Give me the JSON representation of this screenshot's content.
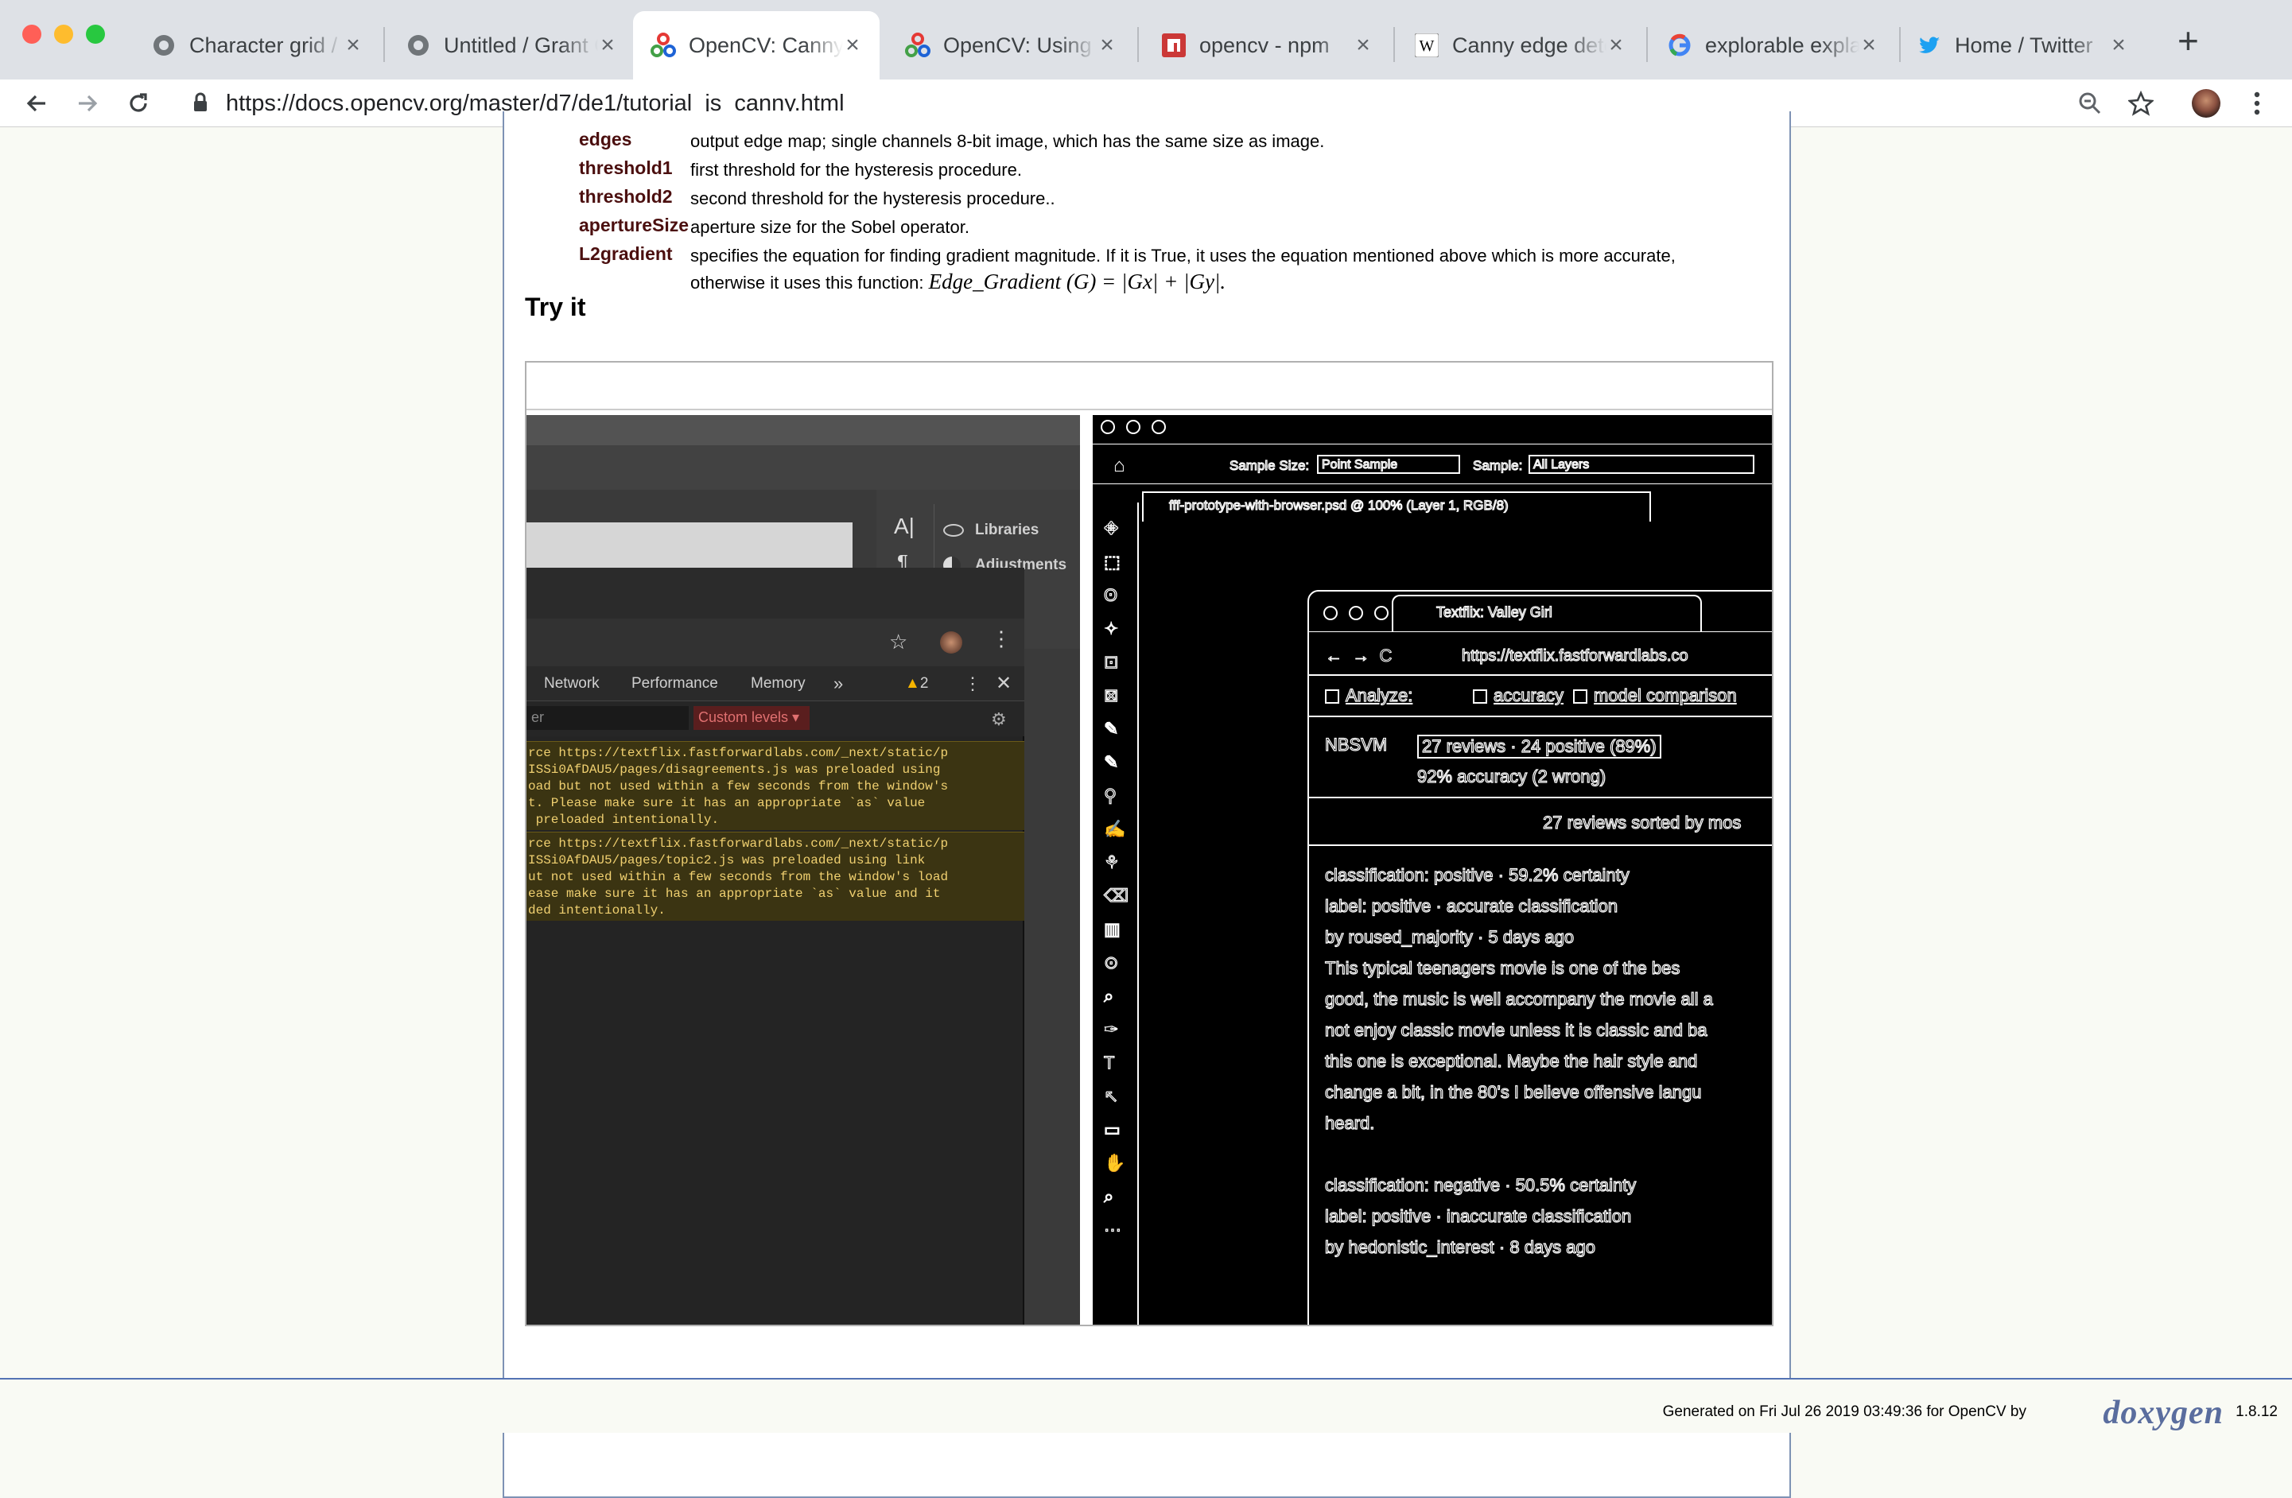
{
  "window": {
    "traffic_colors": [
      "#ff5f57",
      "#febc2e",
      "#28c840"
    ]
  },
  "tabs": [
    {
      "title": "Character grid / G",
      "icon": "observable-icon"
    },
    {
      "title": "Untitled / Grant G",
      "icon": "observable-icon"
    },
    {
      "title": "OpenCV: Canny E",
      "icon": "opencv-icon",
      "active": true
    },
    {
      "title": "OpenCV: Using O",
      "icon": "opencv-icon"
    },
    {
      "title": "opencv - npm",
      "icon": "npm-icon"
    },
    {
      "title": "Canny edge dete",
      "icon": "wikipedia-icon"
    },
    {
      "title": "explorable expla",
      "icon": "google-icon"
    },
    {
      "title": "Home / Twitter",
      "icon": "twitter-icon"
    }
  ],
  "toolbar": {
    "url": "https://docs.opencv.org/master/d7/de1/tutorial_js_canny.html"
  },
  "params": [
    {
      "name": "edges",
      "desc": "output edge map; single channels 8-bit image, which has the same size as image."
    },
    {
      "name": "threshold1",
      "desc": "first threshold for the hysteresis procedure."
    },
    {
      "name": "threshold2",
      "desc": "second threshold for the hysteresis procedure.."
    },
    {
      "name": "apertureSize",
      "desc": "aperture size for the Sobel operator."
    },
    {
      "name": "L2gradient",
      "desc": "specifies the equation for finding gradient magnitude. If it is True, it uses the equation mentioned above which is more accurate,",
      "desc2": "otherwise it uses this function:",
      "math": "Edge_Gradient (G) = |Gx| + |Gy|."
    }
  ],
  "section_title": "Try it",
  "left_image": {
    "panel_items": [
      "Libraries",
      "Adjustments"
    ],
    "devtools_tabs": [
      "Network",
      "Performance",
      "Memory",
      "»"
    ],
    "warning_count": "2",
    "filter_placeholder": "er",
    "levels_label": "Custom levels ▾",
    "console_1": "rce https://textflix.fastforwardlabs.com/_next/static/p\nISSi0AfDAU5/pages/disagreements.js was preloaded using\noad but not used within a few seconds from the window's\nt. Please make sure it has an appropriate `as` value\n preloaded intentionally.",
    "console_2": "rce https://textflix.fastforwardlabs.com/_next/static/p\nISSi0AfDAU5/pages/topic2.js was preloaded using link\nut not used within a few seconds from the window's load\nease make sure it has an appropriate `as` value and it\nded intentionally."
  },
  "right_image": {
    "sample_size_label": "Sample Size:",
    "sample_size_value": "Point Sample",
    "sample_label": "Sample:",
    "sample_value": "All Layers",
    "doc_tab": "fff-prototype-with-browser.psd @ 100% (Layer 1, RGB/8)",
    "browser_tab": "Textflix: Valley Girl",
    "browser_url": "https://textflix.fastforwardlabs.co",
    "checks": [
      "Analyze:",
      "accuracy",
      "model comparison"
    ],
    "model": "NBSVM",
    "reviews": "27 reviews · 24 positive (89%)",
    "accuracy": "92% accuracy (2 wrong)",
    "sorted": "27 reviews sorted by mos",
    "lines": [
      "classification: positive · 59.2% certainty",
      "label: positive · accurate classification",
      "by roused_majority · 5 days ago",
      "    This typical teenagers movie is one of the bes",
      "good, the music is well accompany the movie all a",
      "not enjoy classic movie unless it is classic and ba",
      "this one is exceptional. Maybe the hair style and",
      "change a bit, in the 80's I believe offensive langu",
      "heard.",
      "",
      "classification: negative · 50.5% certainty",
      "label: positive · inaccurate classification",
      "by hedonistic_interest · 8 days ago"
    ]
  },
  "footer": {
    "generated": "Generated on Fri Jul 26 2019 03:49:36 for OpenCV by",
    "logo": "doxygen",
    "version": "1.8.12"
  }
}
